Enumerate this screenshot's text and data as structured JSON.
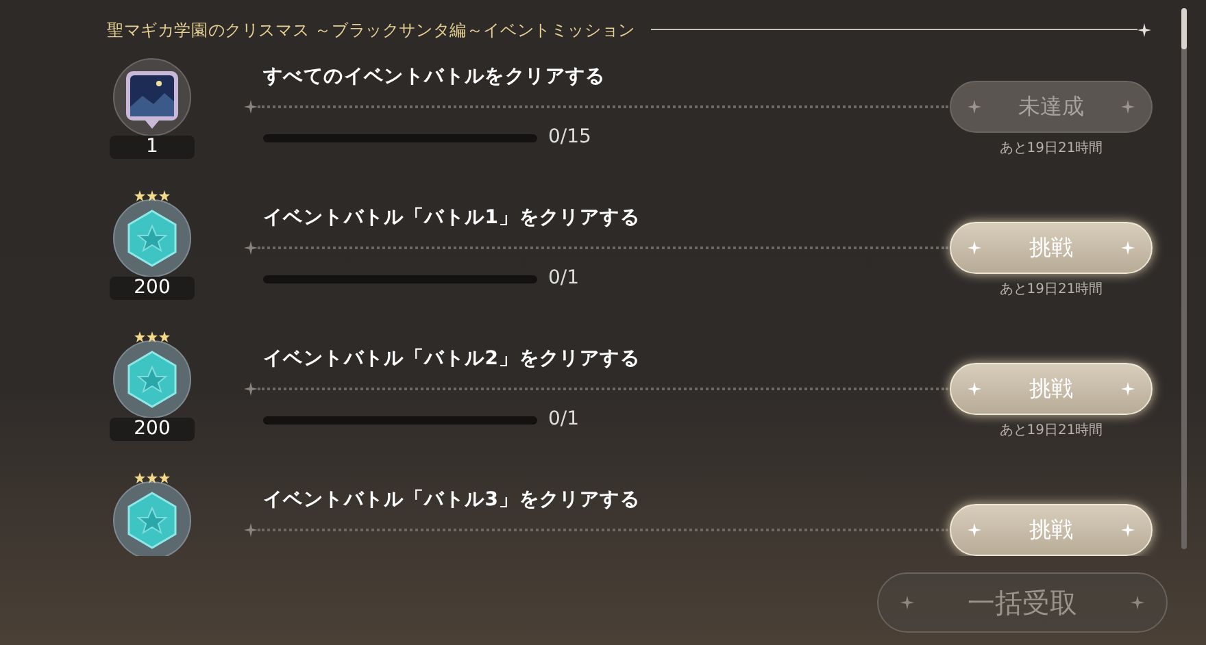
{
  "header": {
    "title": "聖マギカ学園のクリスマス ～ブラックサンタ編～イベントミッション"
  },
  "missions": [
    {
      "title": "すべてのイベントバトルをクリアする",
      "reward": {
        "kind": "card",
        "count": "1"
      },
      "progress": {
        "level": 0,
        "text": "0/15"
      },
      "button": {
        "label": "未達成",
        "disabled": true
      },
      "remaining": "あと19日21時間"
    },
    {
      "title": "イベントバトル「バトル1」をクリアする",
      "reward": {
        "kind": "gem",
        "count": "200",
        "stars": 3
      },
      "progress": {
        "level": 0,
        "text": "0/1"
      },
      "button": {
        "label": "挑戦",
        "disabled": false
      },
      "remaining": "あと19日21時間"
    },
    {
      "title": "イベントバトル「バトル2」をクリアする",
      "reward": {
        "kind": "gem",
        "count": "200",
        "stars": 3
      },
      "progress": {
        "level": 0,
        "text": "0/1"
      },
      "button": {
        "label": "挑戦",
        "disabled": false
      },
      "remaining": "あと19日21時間"
    },
    {
      "title": "イベントバトル「バトル3」をクリアする",
      "reward": {
        "kind": "gem",
        "stars": 3
      },
      "button": {
        "label": "挑戦",
        "disabled": false
      }
    }
  ],
  "bulk_button": {
    "label": "一括受取",
    "disabled": true
  }
}
